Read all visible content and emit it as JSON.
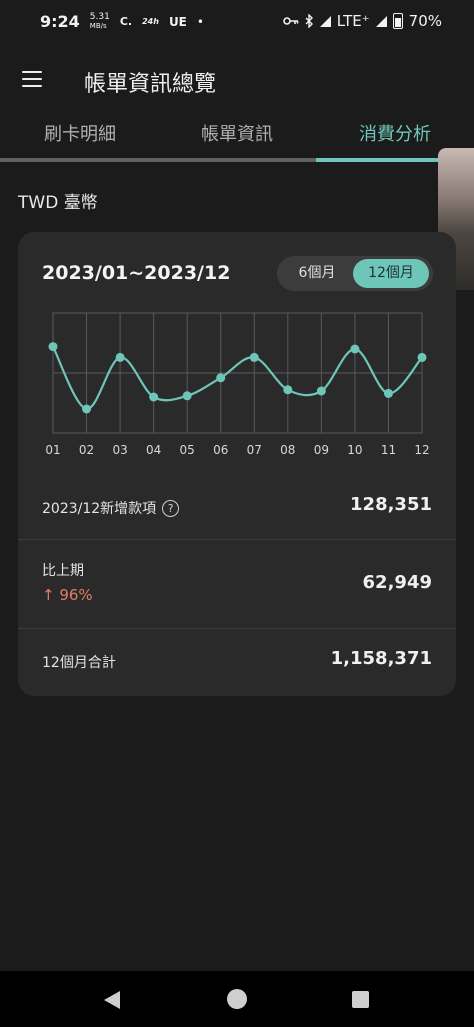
{
  "status_bar": {
    "time": "9:24",
    "net_speed_value": "5.31",
    "net_speed_unit": "MB/s",
    "icons_left": [
      "C.",
      "24h",
      "UE",
      "•"
    ],
    "network": "LTE⁺",
    "battery": "70%"
  },
  "app_bar": {
    "title": "帳單資訊總覽",
    "menu_icon": "hamburger-menu-icon"
  },
  "tabs": [
    {
      "label": "刷卡明細",
      "active": false
    },
    {
      "label": "帳單資訊",
      "active": false
    },
    {
      "label": "消費分析",
      "active": true
    }
  ],
  "currency": "TWD 臺幣",
  "card": {
    "range": "2023/01~2023/12",
    "toggle": {
      "options": [
        "6個月",
        "12個月"
      ],
      "selected": "12個月"
    }
  },
  "chart_data": {
    "type": "line",
    "categories": [
      "01",
      "02",
      "03",
      "04",
      "05",
      "06",
      "07",
      "08",
      "09",
      "10",
      "11",
      "12"
    ],
    "series": [
      {
        "values": [
          0.72,
          0.2,
          0.63,
          0.3,
          0.31,
          0.46,
          0.63,
          0.36,
          0.35,
          0.7,
          0.33,
          0.63
        ]
      }
    ],
    "ylim": [
      0,
      1
    ],
    "grid": true,
    "color": "#6ec6b9",
    "title": "",
    "xlabel": "",
    "ylabel": ""
  },
  "stats": {
    "new_label": "2023/12新增款項",
    "new_value": "128,351",
    "compare_label": "比上期",
    "compare_change": "↑ 96%",
    "compare_value": "62,949",
    "total_label": "12個月合計",
    "total_value": "1,158,371"
  },
  "colors": {
    "accent": "#6ec6b9",
    "increase": "#e57b6a",
    "background": "#1b1b1b",
    "card": "#2a2a2a"
  },
  "nav_bar": {
    "icons": [
      "back-icon",
      "home-icon",
      "recents-icon"
    ]
  }
}
